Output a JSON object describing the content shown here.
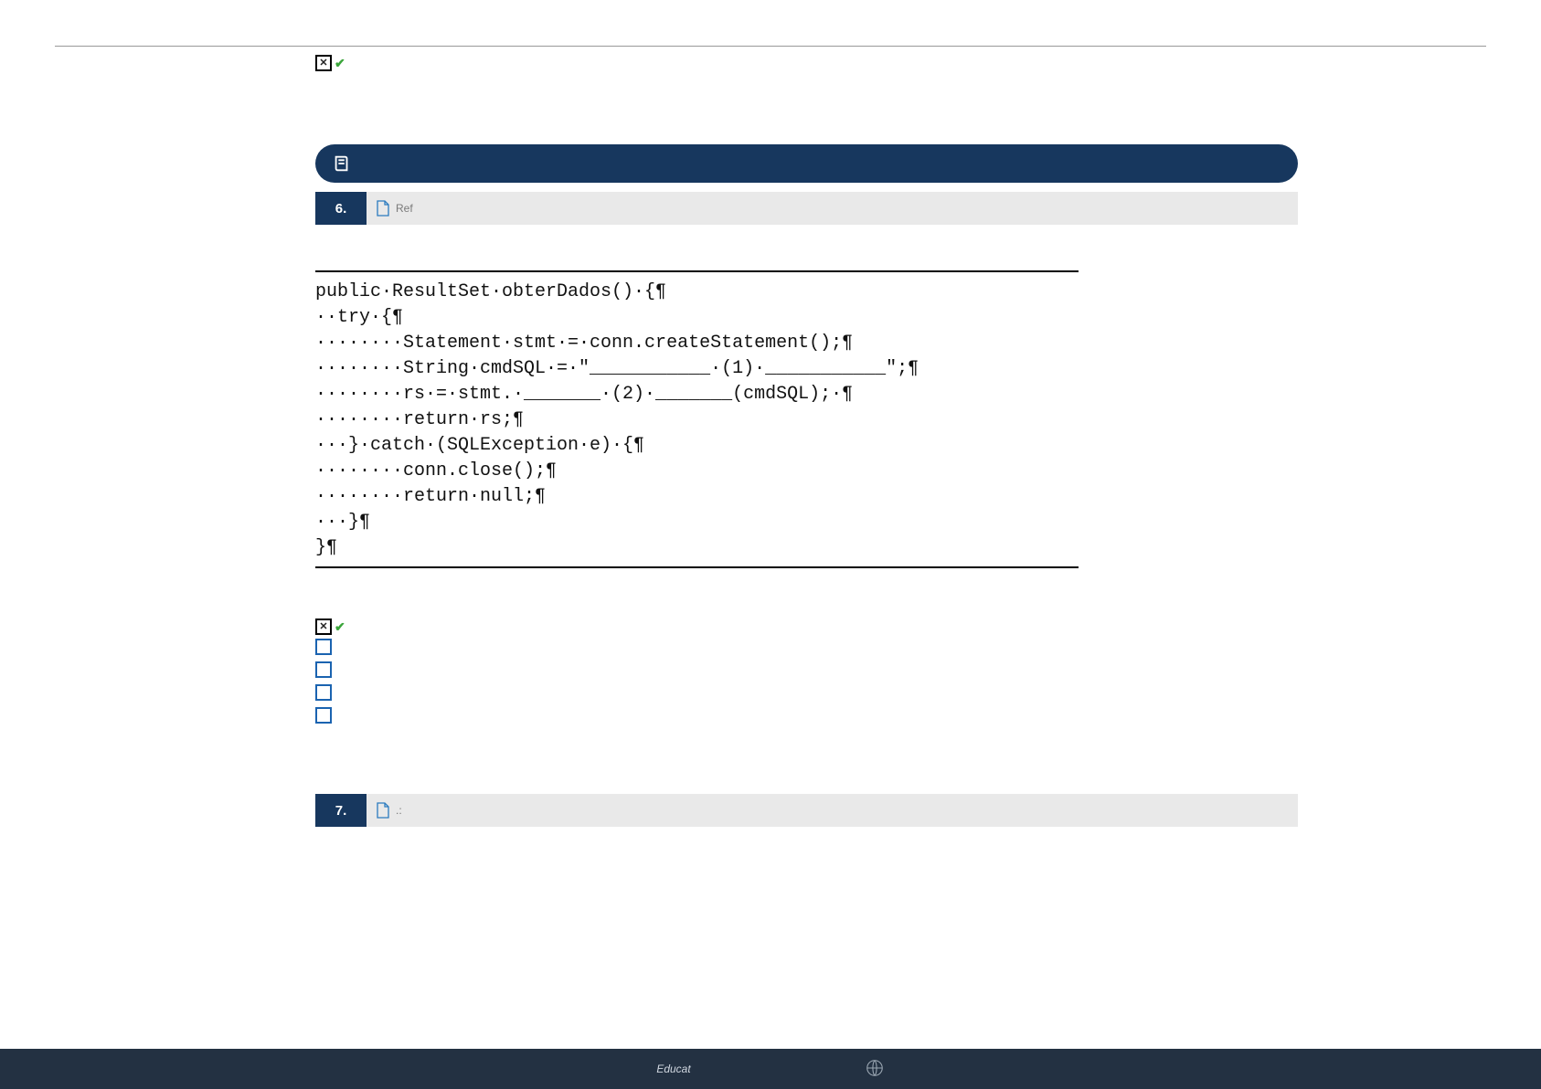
{
  "top_status": {},
  "question6": {
    "number": "6.",
    "ref_label": "Ref"
  },
  "code": {
    "lines": [
      "public·ResultSet·obterDados()·{¶",
      "··try·{¶",
      "········Statement·stmt·=·conn.createStatement();¶",
      "········String·cmdSQL·=·\"___________·(1)·___________\";¶",
      "········rs·=·stmt.·_______·(2)·_______(cmdSQL);·¶",
      "········return·rs;¶",
      "···}·catch·(SQLException·e)·{¶",
      "········conn.close();¶",
      "········return·null;¶",
      "···}¶",
      "}¶"
    ]
  },
  "question7": {
    "number": "7.",
    "sub_label": ".:"
  },
  "footer": {
    "brand": "Educat"
  }
}
